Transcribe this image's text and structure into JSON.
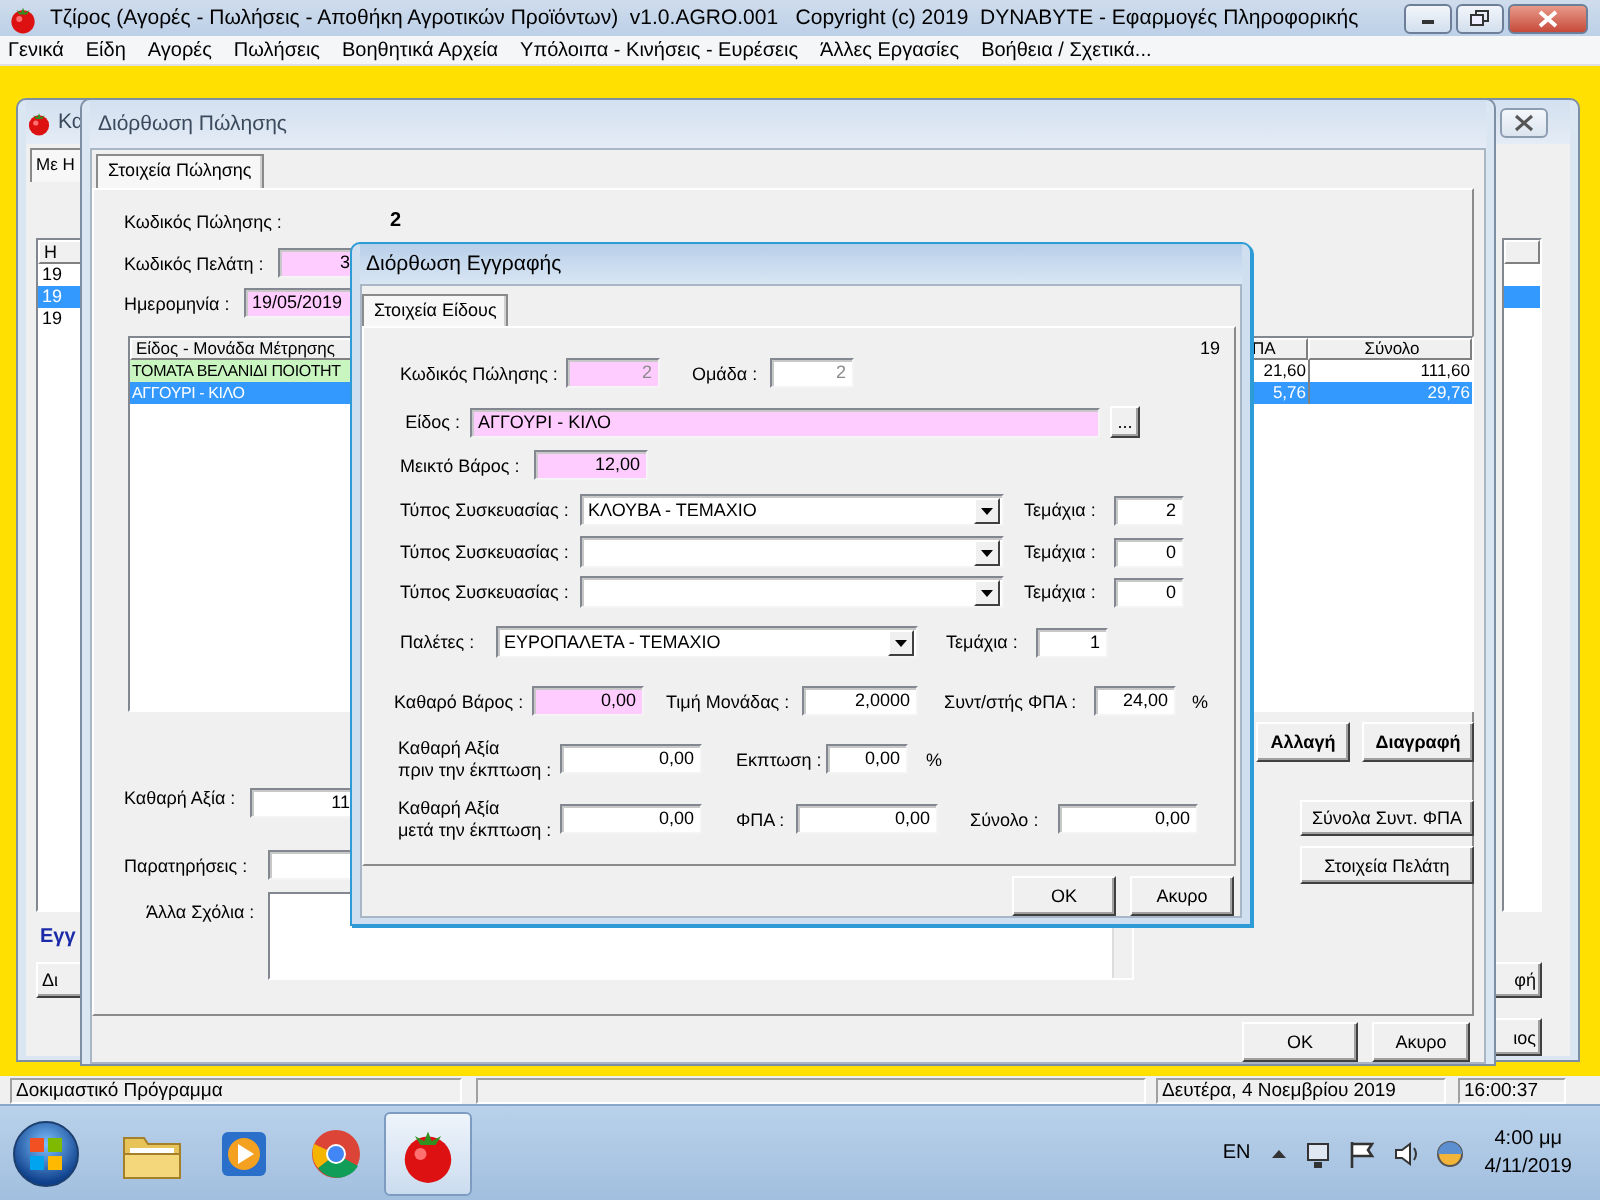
{
  "app": {
    "title": "Τζίρος (Αγορές - Πωλήσεις - Αποθήκη Αγροτικών Προϊόντων)  v1.0.AGRO.001   Copyright (c) 2019  DYNABYTE - Εφαρμογές Πληροφορικής"
  },
  "menu": [
    "Γενικά",
    "Είδη",
    "Αγορές",
    "Πωλήσεις",
    "Βοηθητικά Αρχεία",
    "Υπόλοιπα - Κινήσεις - Ευρέσεις",
    "Άλλες Εργασίες",
    "Βοήθεια / Σχετικά..."
  ],
  "list_window": {
    "title": "Κα",
    "tab": "Με Η",
    "list_header": "Η",
    "list_rows": [
      {
        "text": "19",
        "selected": false
      },
      {
        "text": "19",
        "selected": true
      },
      {
        "text": "19",
        "selected": false
      }
    ],
    "section_label": "Εγγ",
    "left_button": "Δι",
    "right_list_rows": [
      {
        "selected": false
      },
      {
        "selected": true
      }
    ],
    "right_buttons": [
      "φή",
      "ιος"
    ]
  },
  "sale_window": {
    "title": "Διόρθωση Πώλησης",
    "tab": "Στοιχεία Πώλησης",
    "sale_code": {
      "label": "Κωδικός Πώλησης :",
      "value": "2"
    },
    "customer_code": {
      "label": "Κωδικός Πελάτη :",
      "value": "3",
      "highlighted": true
    },
    "date": {
      "label": "Ημερομηνία :",
      "value": "19/05/2019",
      "highlighted": true
    },
    "items_table": {
      "columns": [
        "Είδος - Μονάδα Μέτρησης",
        "ΠΑ",
        "Σύνολο"
      ],
      "rows": [
        {
          "cells": [
            "ΤΟΜΑΤΑ ΒΕΛΑΝΙΔΙ ΠΟΙΟΤΗΤ",
            "21,60",
            "111,60"
          ],
          "highlighted": true,
          "selected": false
        },
        {
          "cells": [
            "ΑΓΓΟΥΡΙ - ΚΙΛΟ",
            "5,76",
            "29,76"
          ],
          "highlighted": false,
          "selected": true
        }
      ]
    },
    "row_buttons": [
      "Αλλαγή",
      "Διαγραφή"
    ],
    "net_value": {
      "label": "Καθαρή Αξία :",
      "value": "11"
    },
    "side_buttons": [
      "Σύνολα Συντ. ΦΠΑ",
      "Στοιχεία Πελάτη"
    ],
    "notes": {
      "label": "Παρατηρήσεις :"
    },
    "comments": {
      "label": "Άλλα Σχόλια :"
    },
    "buttons": [
      "OK",
      "Ακυρο"
    ]
  },
  "entry_dialog": {
    "title": "Διόρθωση Εγγραφής",
    "tab": "Στοιχεία Είδους",
    "record_number": "19",
    "sale_code": {
      "label": "Κωδικός Πώλησης :",
      "value": "2",
      "highlighted": true,
      "disabled": true
    },
    "group": {
      "label": "Ομάδα :",
      "value": "2",
      "disabled": true
    },
    "item": {
      "label": "Είδος :",
      "value": "ΑΓΓΟΥΡΙ - ΚΙΛΟ",
      "highlighted": true
    },
    "browse_button": "...",
    "gross_weight": {
      "label": "Μεικτό Βάρος :",
      "value": "12,00",
      "highlighted": true
    },
    "packaging": [
      {
        "label": "Τύπος Συσκευασίας :",
        "value": "ΚΛΟΥΒΑ - ΤΕΜΑΧΙΟ",
        "pieces_label": "Τεμάχια :",
        "pieces": "2"
      },
      {
        "label": "Τύπος Συσκευασίας :",
        "pieces_label": "Τεμάχια :",
        "pieces": "0"
      },
      {
        "label": "Τύπος Συσκευασίας :",
        "pieces_label": "Τεμάχια :",
        "pieces": "0"
      }
    ],
    "pallets": {
      "label": "Παλέτες :",
      "value": "ΕΥΡΟΠΑΛΕΤΑ - ΤΕΜΑΧΙΟ",
      "pieces_label": "Τεμάχια :",
      "pieces": "1"
    },
    "net_weight": {
      "label": "Καθαρό Βάρος :",
      "value": "0,00",
      "highlighted": true
    },
    "unit_price": {
      "label": "Τιμή Μονάδας :",
      "value": "2,0000"
    },
    "vat_rate": {
      "label": "Συντ/στής ΦΠΑ :",
      "value": "24,00",
      "unit": "%"
    },
    "net_before": {
      "label": "Καθαρή Αξία\nπριν την έκπτωση :",
      "value": "0,00"
    },
    "discount": {
      "label": "Εκπτωση :",
      "value": "0,00",
      "unit": "%"
    },
    "net_after": {
      "label": "Καθαρή Αξία\nμετά την έκπτωση :",
      "value": "0,00"
    },
    "vat": {
      "label": "ΦΠΑ :",
      "value": "0,00"
    },
    "total": {
      "label": "Σύνολο :",
      "value": "0,00"
    },
    "buttons": [
      "OK",
      "Ακυρο"
    ]
  },
  "status_bar": {
    "program": "Δοκιμαστικό Πρόγραμμα",
    "date": "Δευτέρα, 4 Νοεμβρίου 2019",
    "time": "16:00:37"
  },
  "taskbar": {
    "apps": [
      {
        "kind": "folder",
        "active": false
      },
      {
        "kind": "media",
        "active": false
      },
      {
        "kind": "browser",
        "active": false
      },
      {
        "kind": "tomato",
        "active": true
      }
    ],
    "language": "EN",
    "clock_time": "4:00 μμ",
    "clock_date": "4/11/2019"
  }
}
